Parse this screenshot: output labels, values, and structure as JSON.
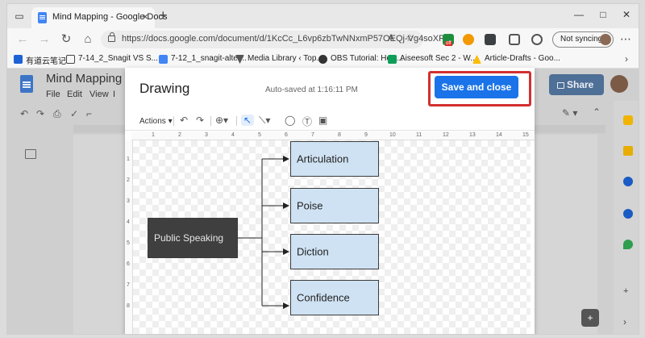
{
  "browser": {
    "tab_title": "Mind Mapping - Google Docs",
    "url": "https://docs.google.com/document/d/1KcCc_L6vp6zbTwNNxmP57OEQj-Vg4soXR...",
    "ext_badge": "off",
    "profile_status": "Not syncing",
    "bookmarks": [
      "有道云笔记",
      "7-14_2_Snagit VS S...",
      "7-12_1_snagit-alter...",
      "Media Library ‹ Top...",
      "OBS Tutorial: How...",
      "Aiseesoft Sec 2 - W...",
      "Article-Drafts - Goo..."
    ]
  },
  "docs": {
    "title": "Mind Mapping",
    "menu": [
      "File",
      "Edit",
      "View",
      "I"
    ],
    "share_label": "Share"
  },
  "drawing": {
    "title": "Drawing",
    "autosave": "Auto-saved at 1:16:11 PM",
    "save_label": "Save and close",
    "actions_label": "Actions",
    "ruler_h": [
      "1",
      "2",
      "3",
      "4",
      "5",
      "6",
      "7",
      "8",
      "9",
      "10",
      "11",
      "12",
      "13",
      "14",
      "15"
    ],
    "ruler_v": [
      "1",
      "2",
      "3",
      "4",
      "5",
      "6",
      "7",
      "8"
    ],
    "root": "Public Speaking",
    "children": [
      "Articulation",
      "Poise",
      "Diction",
      "Confidence"
    ]
  },
  "colors": {
    "accent": "#1a73e8",
    "highlight": "#d32f2f",
    "node_fill": "#cfe2f3",
    "root_fill": "#3f3f3f"
  }
}
